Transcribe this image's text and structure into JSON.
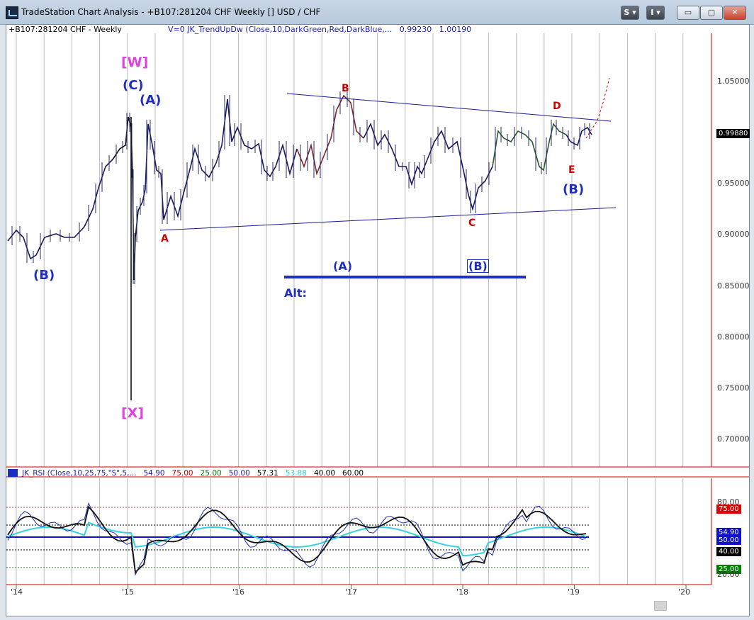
{
  "window": {
    "title": "TradeStation Chart Analysis - +B107:281204 CHF Weekly [] USD / CHF",
    "btn_s": "S",
    "btn_i": "I",
    "btn_min": "▭",
    "btn_max": "▢",
    "btn_close": "✕"
  },
  "chart": {
    "symbol_label": "+B107:281204 CHF - Weekly",
    "indicator_label": "V=0  JK_TrendUpDw (Close,10,DarkGreen,Red,DarkBlue,...",
    "indicator_val1": "0.99230",
    "indicator_val2": "1.00190",
    "last_price": "0.99880",
    "price_ticks": [
      "1.05000",
      "0.95000",
      "0.90000",
      "0.85000",
      "0.80000",
      "0.75000",
      "0.70000"
    ]
  },
  "rsi": {
    "label": "JK_RSI (Close,10,25,75,\"S\",5,...",
    "v1": "54.90",
    "v2": "75.00",
    "v3": "25.00",
    "v4": "50.00",
    "v5": "57.31",
    "v6": "53.88",
    "v7": "40.00",
    "v8": "60.00",
    "ticks": [
      "80.00",
      "20.00"
    ],
    "tag_75": "75.00",
    "tag_549": "54.90",
    "tag_50": "50.00",
    "tag_40": "40.00",
    "tag_25": "25.00"
  },
  "time_axis": [
    "'14",
    "'15",
    "'16",
    "'17",
    "'18",
    "'19",
    "'20"
  ],
  "waves": {
    "W": "[W]",
    "C_top": "(C)",
    "A_top": "(A)",
    "B_left": "(B)",
    "X": "[X]",
    "a_low": "A",
    "b_high": "B",
    "c_low": "C",
    "d_high": "D",
    "e_low": "E",
    "B_right": "(B)",
    "alt_A": "(A)",
    "alt_B": "(B)",
    "alt": "Alt:"
  },
  "colors": {
    "price_axis": "#cc0000",
    "wave_blue": "#1f2fbf",
    "wave_red": "#d10000",
    "wave_magenta": "#e040e0",
    "trend_line": "#1a1a9c",
    "rsi_cyan": "#36d2e0",
    "rsi_blue": "#1010d0"
  }
}
